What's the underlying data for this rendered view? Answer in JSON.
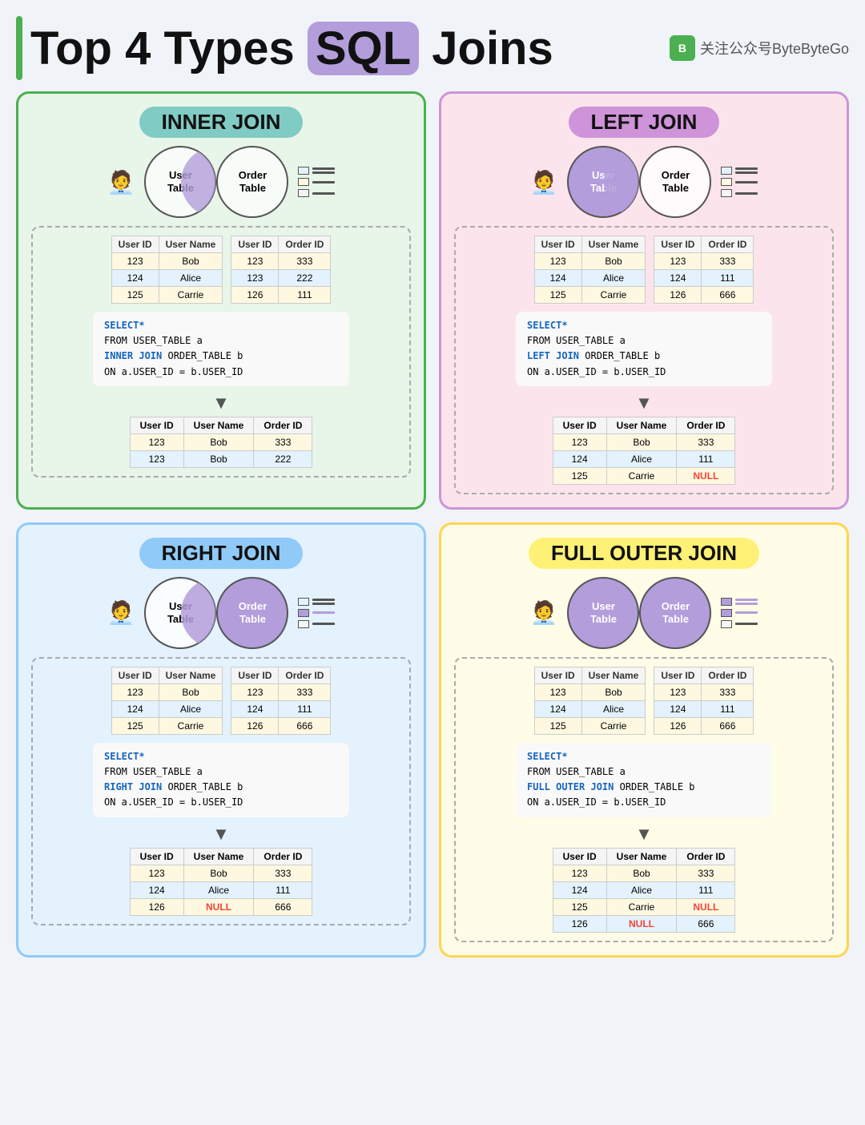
{
  "header": {
    "title_prefix": "Top 4 Types ",
    "title_sql": "SQL",
    "title_suffix": " Joins",
    "brand": "关注公众号ByteByteGo"
  },
  "inner_join": {
    "title": "INNER JOIN",
    "left_circle": "User\nTable",
    "right_circle": "Order\nTable",
    "user_table": {
      "headers": [
        "User ID",
        "User Name"
      ],
      "rows": [
        [
          "123",
          "Bob"
        ],
        [
          "124",
          "Alice"
        ],
        [
          "125",
          "Carrie"
        ]
      ]
    },
    "order_table": {
      "headers": [
        "User ID",
        "Order ID"
      ],
      "rows": [
        [
          "123",
          "333"
        ],
        [
          "123",
          "222"
        ],
        [
          "126",
          "111"
        ]
      ]
    },
    "sql": "SELECT*\nFROM USER_TABLE a\nINNER JOIN ORDER_TABLE b\nON a.USER_ID = b.USER_ID",
    "result_table": {
      "headers": [
        "User ID",
        "User Name",
        "Order ID"
      ],
      "rows": [
        [
          "123",
          "Bob",
          "333"
        ],
        [
          "123",
          "Bob",
          "222"
        ]
      ]
    }
  },
  "left_join": {
    "title": "LEFT JOIN",
    "left_circle": "User\nTable",
    "right_circle": "Order\nTable",
    "user_table": {
      "headers": [
        "User ID",
        "User Name"
      ],
      "rows": [
        [
          "123",
          "Bob"
        ],
        [
          "124",
          "Alice"
        ],
        [
          "125",
          "Carrie"
        ]
      ]
    },
    "order_table": {
      "headers": [
        "User ID",
        "Order ID"
      ],
      "rows": [
        [
          "123",
          "333"
        ],
        [
          "124",
          "111"
        ],
        [
          "126",
          "666"
        ]
      ]
    },
    "sql": "SELECT*\nFROM USER_TABLE a\nLEFT JOIN ORDER_TABLE b\nON a.USER_ID = b.USER_ID",
    "result_table": {
      "headers": [
        "User ID",
        "User Name",
        "Order ID"
      ],
      "rows": [
        [
          "123",
          "Bob",
          "333"
        ],
        [
          "124",
          "Alice",
          "111"
        ],
        [
          "125",
          "Carrie",
          "NULL"
        ]
      ]
    }
  },
  "right_join": {
    "title": "RIGHT JOIN",
    "left_circle": "User\nTable",
    "right_circle": "Order\nTable",
    "user_table": {
      "headers": [
        "User ID",
        "User Name"
      ],
      "rows": [
        [
          "123",
          "Bob"
        ],
        [
          "124",
          "Alice"
        ],
        [
          "125",
          "Carrie"
        ]
      ]
    },
    "order_table": {
      "headers": [
        "User ID",
        "Order ID"
      ],
      "rows": [
        [
          "123",
          "333"
        ],
        [
          "124",
          "111"
        ],
        [
          "126",
          "666"
        ]
      ]
    },
    "sql": "SELECT*\nFROM USER_TABLE a\nRIGHT JOIN ORDER_TABLE b\nON a.USER_ID = b.USER_ID",
    "result_table": {
      "headers": [
        "User ID",
        "User Name",
        "Order ID"
      ],
      "rows": [
        [
          "123",
          "Bob",
          "333"
        ],
        [
          "124",
          "Alice",
          "111"
        ],
        [
          "126",
          "NULL",
          "666"
        ]
      ]
    }
  },
  "full_outer_join": {
    "title": "FULL OUTER JOIN",
    "left_circle": "User\nTable",
    "right_circle": "Order\nTable",
    "user_table": {
      "headers": [
        "User ID",
        "User Name"
      ],
      "rows": [
        [
          "123",
          "Bob"
        ],
        [
          "124",
          "Alice"
        ],
        [
          "125",
          "Carrie"
        ]
      ]
    },
    "order_table": {
      "headers": [
        "User ID",
        "Order ID"
      ],
      "rows": [
        [
          "123",
          "333"
        ],
        [
          "124",
          "111"
        ],
        [
          "126",
          "666"
        ]
      ]
    },
    "sql": "SELECT*\nFROM USER_TABLE a\nFULL OUTER JOIN ORDER_TABLE b\nON a.USER_ID = b.USER_ID",
    "result_table": {
      "headers": [
        "User ID",
        "User Name",
        "Order ID"
      ],
      "rows": [
        [
          "123",
          "Bob",
          "333"
        ],
        [
          "124",
          "Alice",
          "111"
        ],
        [
          "125",
          "Carrie",
          "NULL"
        ],
        [
          "126",
          "NULL",
          "666"
        ]
      ]
    }
  }
}
